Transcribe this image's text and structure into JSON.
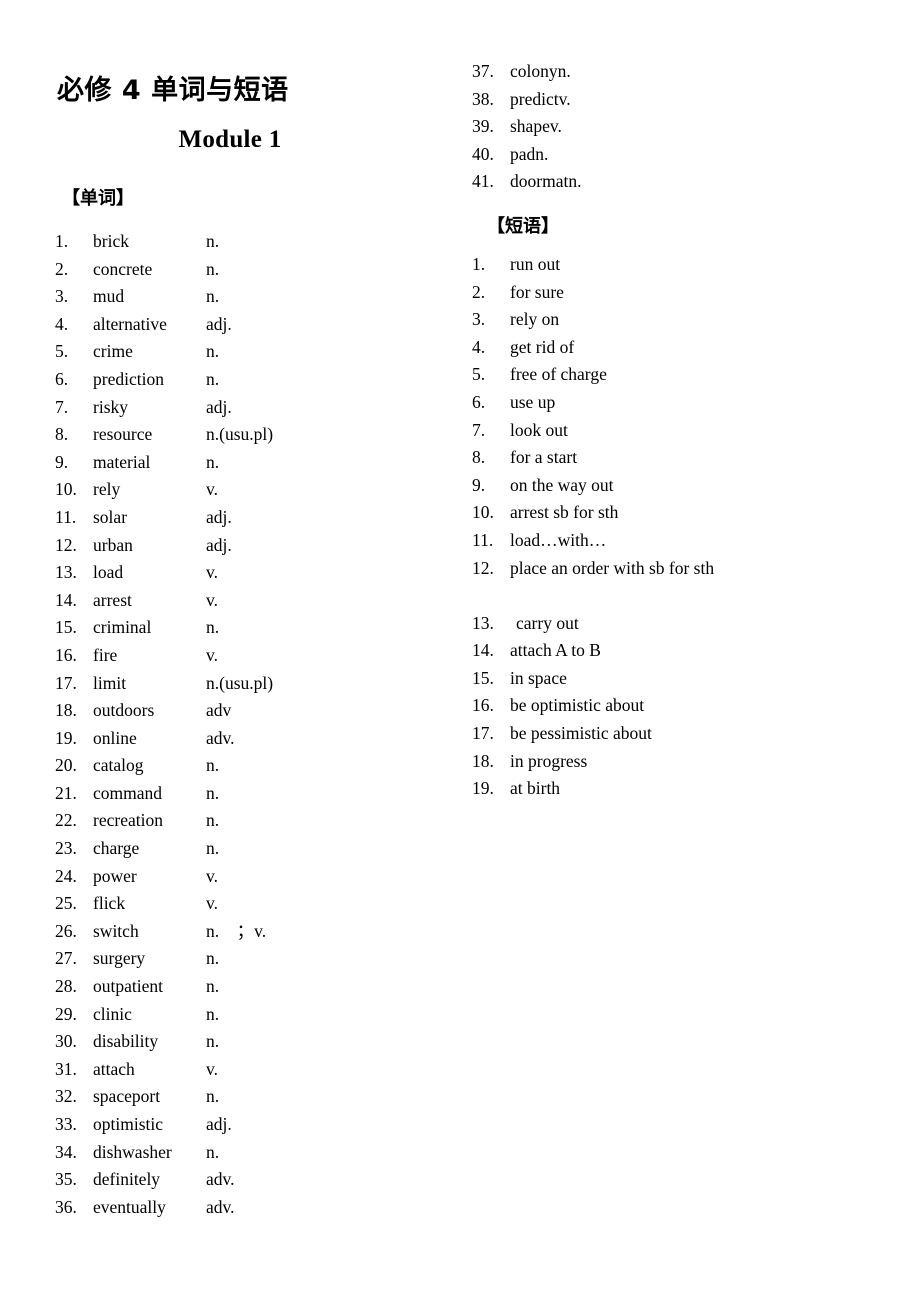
{
  "document": {
    "title": "必修 4 单词与短语",
    "module_heading": "Module 1",
    "words_heading": "【单词】",
    "phrases_heading": "【短语】"
  },
  "words": [
    {
      "num": "1.",
      "term": "brick",
      "pos": "n."
    },
    {
      "num": "2.",
      "term": "concrete",
      "pos": "n."
    },
    {
      "num": "3.",
      "term": "mud",
      "pos": "n."
    },
    {
      "num": "4.",
      "term": "alternative",
      "pos": "adj."
    },
    {
      "num": "5.",
      "term": "crime",
      "pos": "n."
    },
    {
      "num": "6.",
      "term": "prediction",
      "pos": "n."
    },
    {
      "num": "7.",
      "term": "risky",
      "pos": "adj."
    },
    {
      "num": "8.",
      "term": "resource",
      "pos": "n.(usu.pl)"
    },
    {
      "num": "9.",
      "term": "material",
      "pos": "n."
    },
    {
      "num": "10.",
      "term": "rely",
      "pos": "v."
    },
    {
      "num": "11.",
      "term": "solar",
      "pos": "adj."
    },
    {
      "num": "12.",
      "term": "urban",
      "pos": "adj."
    },
    {
      "num": "13.",
      "term": "load",
      "pos": "v."
    },
    {
      "num": "14.",
      "term": "arrest",
      "pos": "v."
    },
    {
      "num": "15.",
      "term": "criminal",
      "pos": "n."
    },
    {
      "num": "16.",
      "term": "fire",
      "pos": "v."
    },
    {
      "num": "17.",
      "term": "limit",
      "pos": "n.(usu.pl)"
    },
    {
      "num": "18.",
      "term": "outdoors",
      "pos": "adv"
    },
    {
      "num": "19.",
      "term": "online",
      "pos": "adv."
    },
    {
      "num": "20.",
      "term": "catalog",
      "pos": "n."
    },
    {
      "num": "21.",
      "term": "command",
      "pos": "n."
    },
    {
      "num": "22.",
      "term": "recreation",
      "pos": "n."
    },
    {
      "num": "23.",
      "term": "charge",
      "pos": "n."
    },
    {
      "num": "24.",
      "term": "power",
      "pos": "v."
    },
    {
      "num": "25.",
      "term": "flick",
      "pos": "v."
    },
    {
      "num": "26.",
      "term": "switch",
      "pos": "n.    ；v."
    },
    {
      "num": "27.",
      "term": "surgery",
      "pos": "n."
    },
    {
      "num": "28.",
      "term": "outpatient",
      "pos": "n."
    },
    {
      "num": "29.",
      "term": "clinic",
      "pos": "n."
    },
    {
      "num": "30.",
      "term": "disability",
      "pos": "n."
    },
    {
      "num": "31.",
      "term": "attach",
      "pos": "v."
    },
    {
      "num": "32.",
      "term": "spaceport",
      "pos": "n."
    },
    {
      "num": "33.",
      "term": "optimistic",
      "pos": "adj."
    },
    {
      "num": "34.",
      "term": "dishwasher",
      "pos": "n."
    },
    {
      "num": "35.",
      "term": "definitely",
      "pos": "adv."
    },
    {
      "num": "36.",
      "term": "eventually",
      "pos": "adv."
    },
    {
      "num": "37.",
      "term": "colony",
      "pos": "n."
    },
    {
      "num": "38.",
      "term": "predict",
      "pos": "v."
    },
    {
      "num": "39.",
      "term": "shape",
      "pos": "v."
    },
    {
      "num": "40.",
      "term": "pad",
      "pos": "n."
    },
    {
      "num": "41.",
      "term": "doormat",
      "pos": "n."
    }
  ],
  "phrases": [
    {
      "num": "1.",
      "term": "run out"
    },
    {
      "num": "2.",
      "term": "for sure"
    },
    {
      "num": "3.",
      "term": "rely on"
    },
    {
      "num": "4.",
      "term": "get rid of"
    },
    {
      "num": "5.",
      "term": "free of charge"
    },
    {
      "num": "6.",
      "term": "use up"
    },
    {
      "num": "7.",
      "term": "look out"
    },
    {
      "num": "8.",
      "term": "for a start"
    },
    {
      "num": "9.",
      "term": "on the way out"
    },
    {
      "num": "10.",
      "term": "arrest sb for sth"
    },
    {
      "num": "11.",
      "term": "load…with…"
    },
    {
      "num": "12.",
      "term": "place an order with sb for sth"
    },
    {
      "num": "13.",
      "term": "carry out"
    },
    {
      "num": "14.",
      "term": "attach A to B"
    },
    {
      "num": "15.",
      "term": "in space"
    },
    {
      "num": "16.",
      "term": "be optimistic about"
    },
    {
      "num": "17.",
      "term": "be pessimistic about"
    },
    {
      "num": "18.",
      "term": "in progress"
    },
    {
      "num": "19.",
      "term": "at birth"
    }
  ]
}
